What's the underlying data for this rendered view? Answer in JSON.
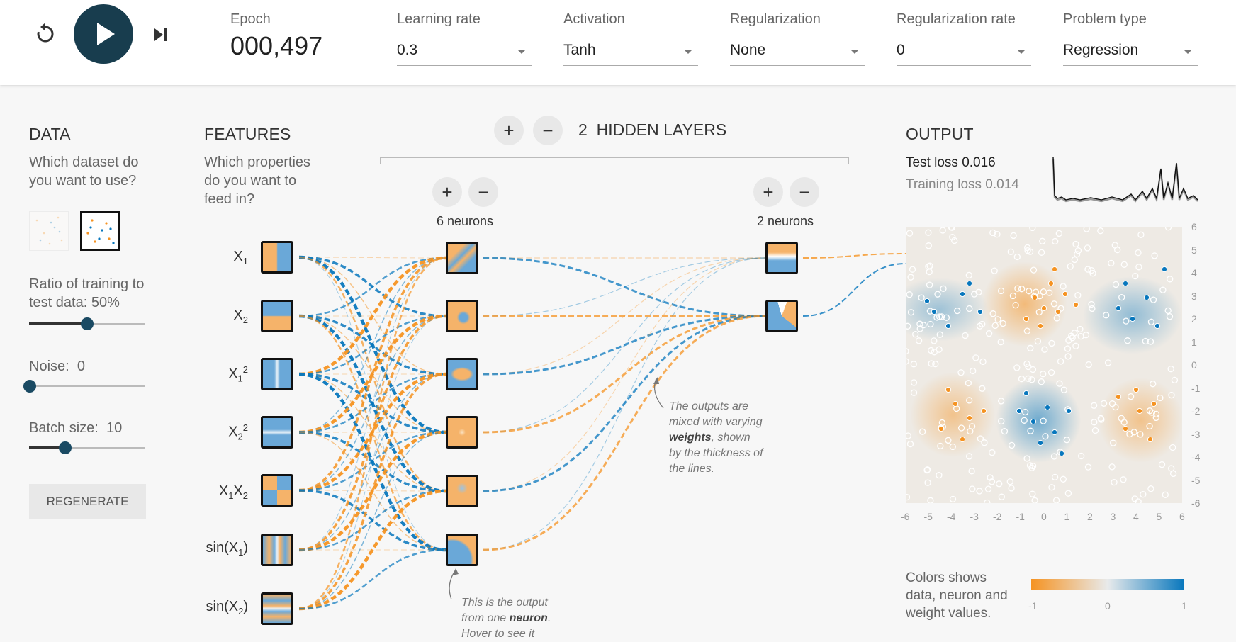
{
  "toolbar": {
    "reset_icon": "reset-icon",
    "play_icon": "play-icon",
    "step_icon": "step-forward-icon",
    "epoch_label": "Epoch",
    "epoch_value": "000,497",
    "controls": [
      {
        "label": "Learning rate",
        "value": "0.3"
      },
      {
        "label": "Activation",
        "value": "Tanh"
      },
      {
        "label": "Regularization",
        "value": "None"
      },
      {
        "label": "Regularization rate",
        "value": "0"
      },
      {
        "label": "Problem type",
        "value": "Regression"
      }
    ]
  },
  "data_panel": {
    "title": "DATA",
    "question": "Which dataset do you want to use?",
    "ratio_label": "Ratio of training to test data:",
    "ratio_value": "50%",
    "ratio_level": 0.5,
    "noise_label": "Noise:",
    "noise_value": "0",
    "noise_level": 0,
    "batch_label": "Batch size:",
    "batch_value": "10",
    "batch_level": 0.3,
    "regenerate": "REGENERATE"
  },
  "features_panel": {
    "title": "FEATURES",
    "question": "Which properties do you want to feed in?",
    "features": [
      "X1",
      "X2",
      "X1^2",
      "X2^2",
      "X1X2",
      "sin(X1)",
      "sin(X2)"
    ]
  },
  "network": {
    "layers_count": "2",
    "layers_label": "HIDDEN LAYERS",
    "layer1_label": "6 neurons",
    "layer2_label": "2 neurons",
    "add_symbol": "+",
    "remove_symbol": "−",
    "note_weights_1": "The outputs are",
    "note_weights_2": "mixed with varying",
    "note_weights_bold": "weights",
    "note_weights_3": ", shown",
    "note_weights_4": "by the thickness of",
    "note_weights_5": "the lines.",
    "note_neuron_1": "This is the output",
    "note_neuron_2": "from one",
    "note_neuron_bold": "neuron",
    "note_neuron_3": ".",
    "note_neuron_4": "Hover to see it"
  },
  "output_panel": {
    "title": "OUTPUT",
    "test_loss_label": "Test loss",
    "test_loss_value": "0.016",
    "training_loss_label": "Training loss",
    "training_loss_value": "0.014",
    "x_ticks": [
      "-6",
      "-5",
      "-4",
      "-3",
      "-2",
      "-1",
      "0",
      "1",
      "2",
      "3",
      "4",
      "5",
      "6"
    ],
    "y_ticks": [
      "6",
      "5",
      "4",
      "3",
      "2",
      "1",
      "0",
      "-1",
      "-2",
      "-3",
      "-4",
      "-5",
      "-6"
    ],
    "legend_text_1": "Colors shows",
    "legend_text_2": "data, neuron and",
    "legend_text_3": "weight values.",
    "legend_min": "-1",
    "legend_mid": "0",
    "legend_max": "1"
  },
  "colors": {
    "orange": "#f59322",
    "blue": "#0877bd",
    "play_bg": "#183d4e"
  }
}
